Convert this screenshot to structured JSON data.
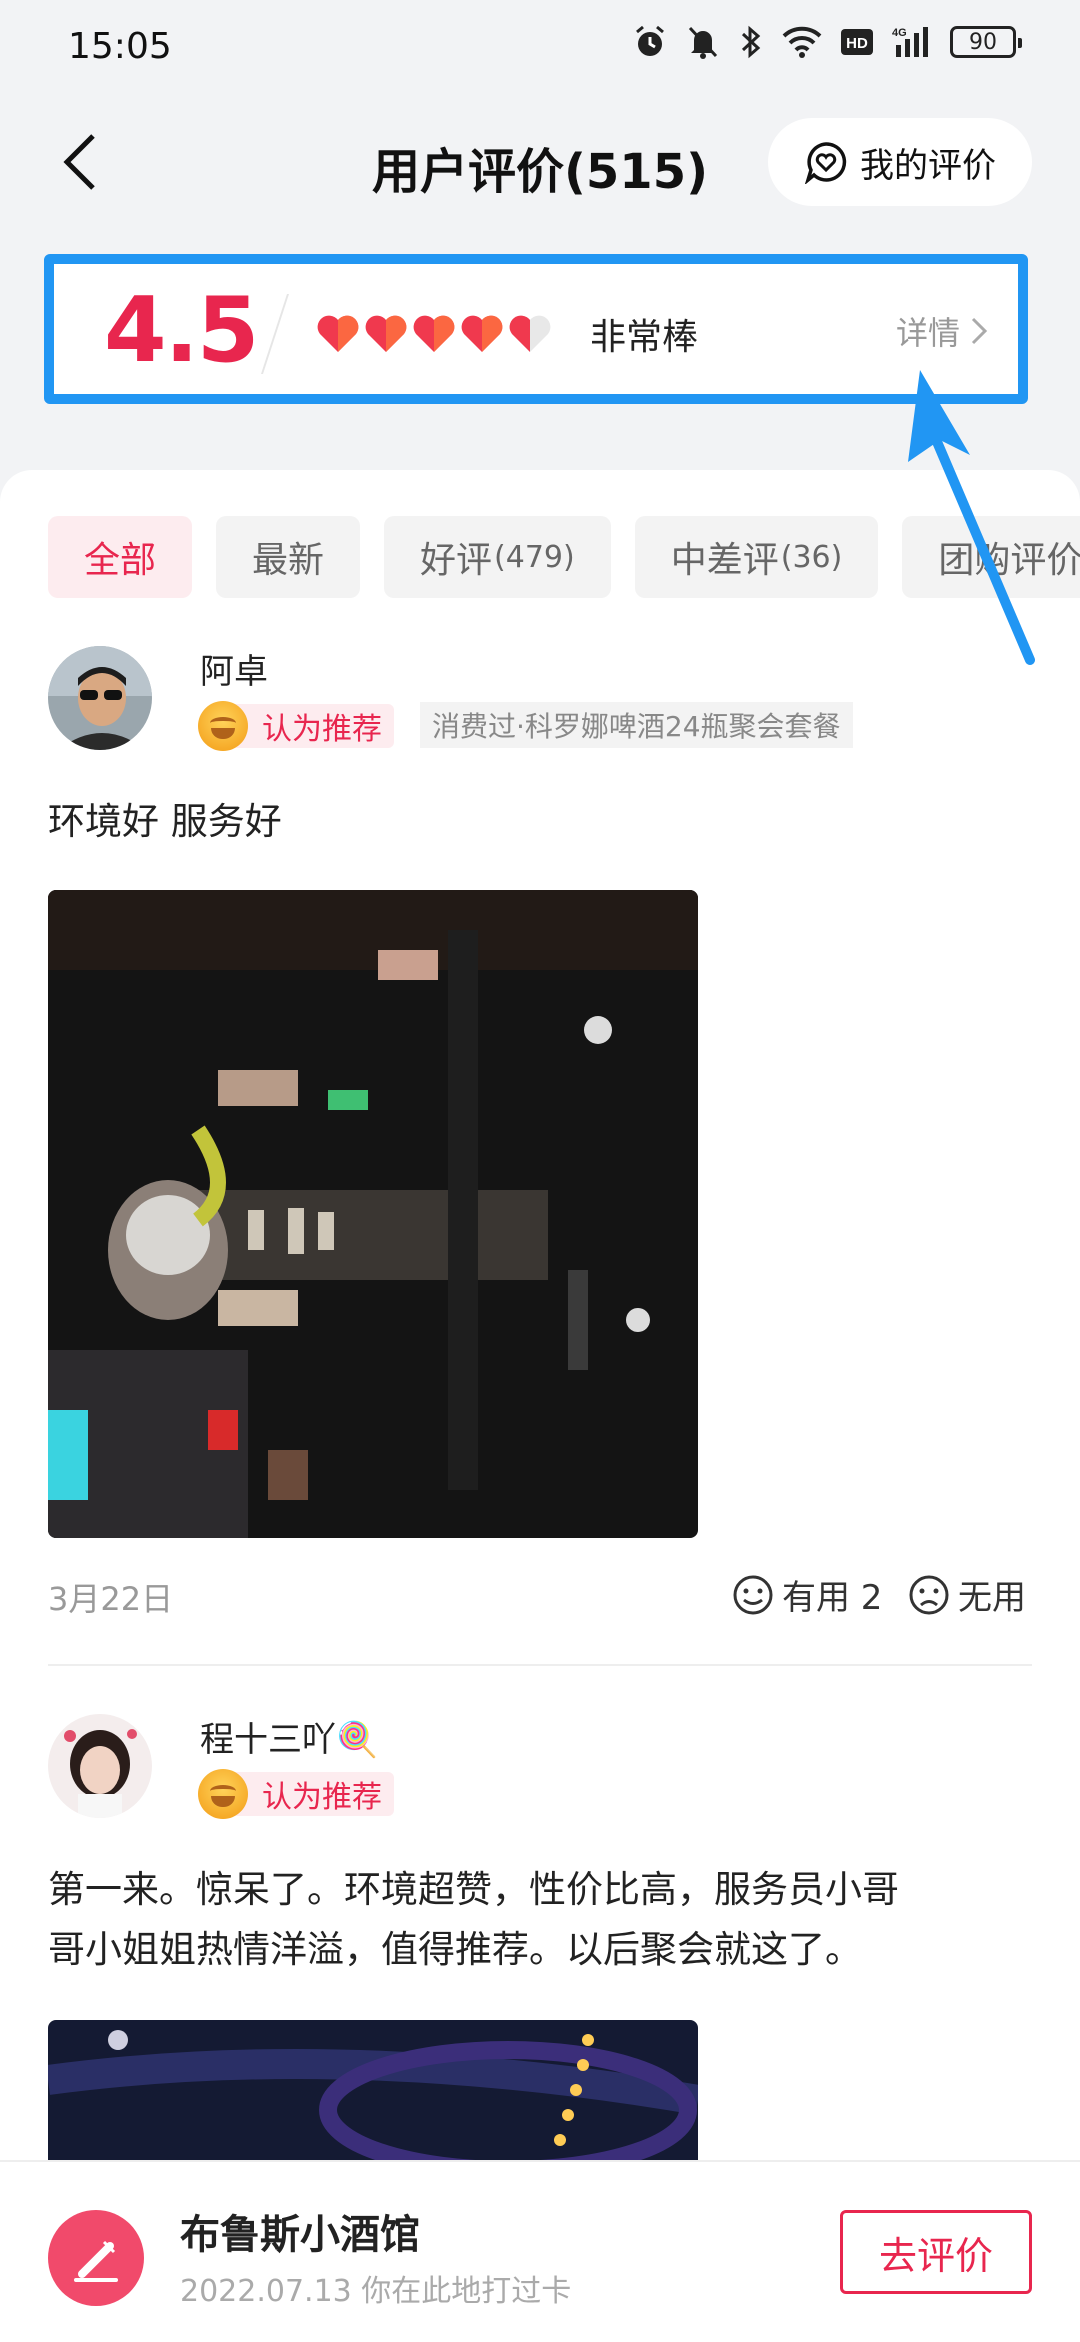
{
  "status_bar": {
    "time": "15:05",
    "battery": "90",
    "icons": [
      "alarm-icon",
      "mute-icon",
      "bluetooth-icon",
      "wifi-icon",
      "hd-icon",
      "signal-icon",
      "battery-icon"
    ]
  },
  "header": {
    "title": "用户评价(515)",
    "my_review_label": "我的评价"
  },
  "rating": {
    "score": "4.5",
    "hearts": 4.5,
    "label": "非常棒",
    "detail_label": "详情"
  },
  "tabs": [
    {
      "label": "全部",
      "count": ""
    },
    {
      "label": "最新",
      "count": ""
    },
    {
      "label": "好评",
      "count": "(479)"
    },
    {
      "label": "中差评",
      "count": "(36)"
    },
    {
      "label": "团购评价",
      "count": ""
    }
  ],
  "reviews": [
    {
      "username": "阿卓",
      "badge": "认为推荐",
      "consumed": "消费过·科罗娜啤酒24瓶聚会套餐",
      "text": "环境好 服务好",
      "date": "3月22日",
      "useful_label": "有用 2",
      "useless_label": "无用"
    },
    {
      "username": "程十三吖🍭",
      "badge": "认为推荐",
      "text_line1": "第一来。惊呆了。环境超赞，性价比高，服务员小哥",
      "text_line2": "哥小姐姐热情洋溢，值得推荐。以后聚会就这了。"
    }
  ],
  "bottom_bar": {
    "shop_name": "布鲁斯小酒馆",
    "checkin": "2022.07.13 你在此地打过卡",
    "go_review_label": "去评价"
  },
  "colors": {
    "accent": "#e8264e",
    "highlight_box": "#2196f3"
  }
}
